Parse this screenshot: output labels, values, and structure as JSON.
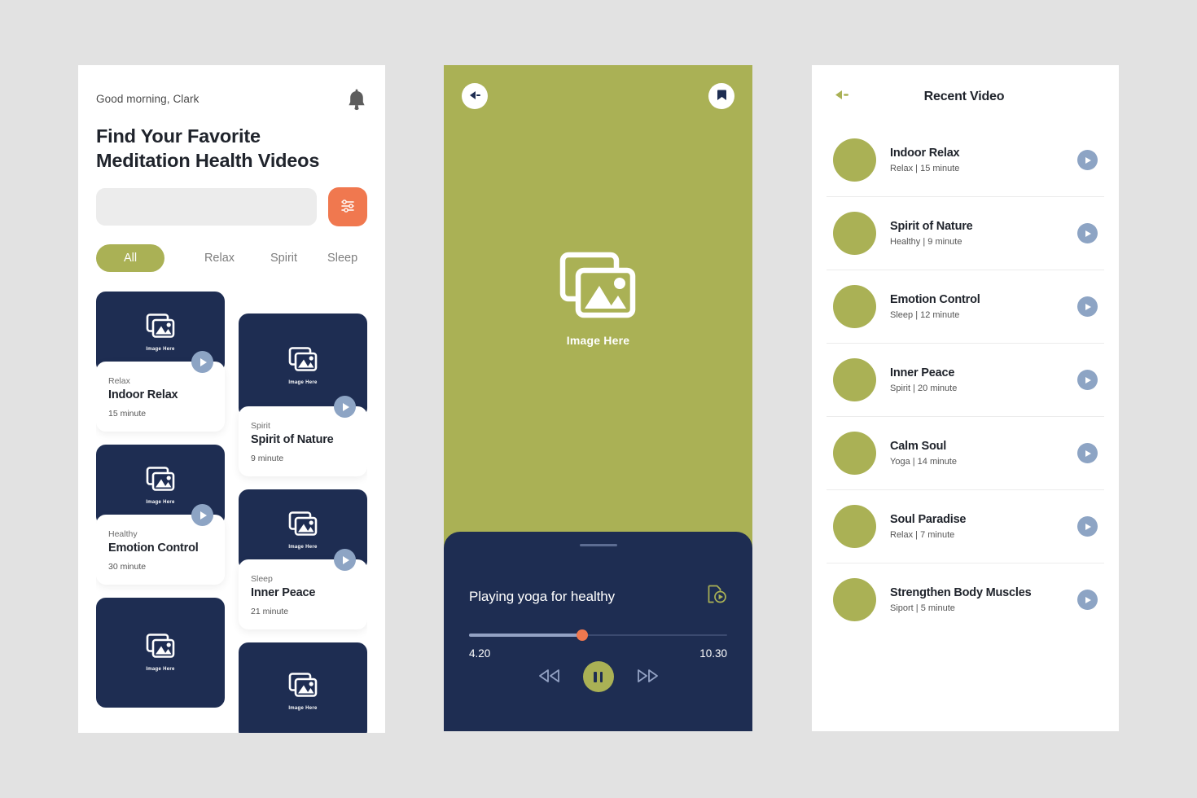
{
  "home": {
    "greeting": "Good morning, Clark",
    "headline_line1": "Find Your Favorite",
    "headline_line2": "Meditation Health Videos",
    "bell_icon": "bell-icon",
    "search": {
      "value": "",
      "placeholder": ""
    },
    "filter_icon": "sliders-icon",
    "tabs": [
      {
        "label": "All",
        "active": true
      },
      {
        "label": "Relax",
        "active": false
      },
      {
        "label": "Spirit",
        "active": false
      },
      {
        "label": "Sleep",
        "active": false
      }
    ],
    "thumb_caption": "Image Here",
    "cards_left": [
      {
        "category": "Relax",
        "title": "Indoor Relax",
        "duration": "15 minute"
      },
      {
        "category": "Healthy",
        "title": "Emotion Control",
        "duration": "30 minute"
      }
    ],
    "cards_right": [
      {
        "category": "Spirit",
        "title": "Spirit of Nature",
        "duration": "9 minute"
      },
      {
        "category": "Sleep",
        "title": "Inner Peace",
        "duration": "21 minute"
      }
    ]
  },
  "player": {
    "back_icon": "back-arrow-icon",
    "bookmark_icon": "bookmark-icon",
    "image_caption": "Image Here",
    "now_playing": "Playing yoga for healthy",
    "playlist_icon": "video-file-icon",
    "current_time": "4.20",
    "total_time": "10.30",
    "progress_percent": 44,
    "rewind_icon": "rewind-icon",
    "pause_icon": "pause-icon",
    "forward_icon": "fast-forward-icon"
  },
  "recent": {
    "back_icon": "back-arrow-icon",
    "title": "Recent Video",
    "items": [
      {
        "name": "Indoor Relax",
        "meta": "Relax | 15 minute"
      },
      {
        "name": "Spirit of Nature",
        "meta": "Healthy | 9 minute"
      },
      {
        "name": "Emotion Control",
        "meta": "Sleep | 12 minute"
      },
      {
        "name": "Inner Peace",
        "meta": "Spirit | 20 minute"
      },
      {
        "name": "Calm Soul",
        "meta": "Yoga | 14 minute"
      },
      {
        "name": "Soul Paradise",
        "meta": "Relax | 7 minute"
      },
      {
        "name": "Strengthen Body Muscles",
        "meta": "Siport  | 5 minute"
      }
    ]
  },
  "colors": {
    "background": "#e2e2e2",
    "olive": "#aab155",
    "navy": "#1e2d52",
    "coral": "#f0784f",
    "play_blue": "#8da4c4"
  }
}
